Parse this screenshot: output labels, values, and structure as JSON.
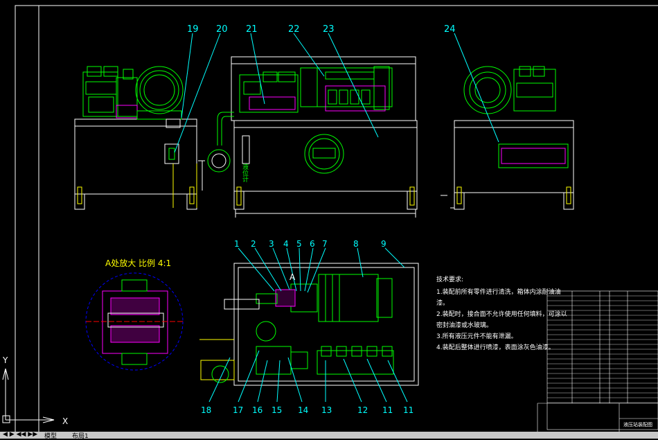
{
  "balloons_top": [
    "19",
    "20",
    "21",
    "22",
    "23",
    "24"
  ],
  "balloons_mid": [
    "1",
    "2",
    "3",
    "4",
    "5",
    "6",
    "7",
    "8",
    "9"
  ],
  "balloons_bottom": [
    "18",
    "17",
    "16",
    "15",
    "14",
    "13",
    "12",
    "11",
    "11"
  ],
  "detail_title": "A处放大 比例 4:1",
  "detail_marker": "A",
  "level_gauge_label": "液位计",
  "tech_notes": {
    "title": "技术要求:",
    "lines": [
      "1.装配前所有零件进行清洗，箱体内涂耐油油",
      "漆。",
      "2.装配时，接合面不允许使用任何填料，可涂以",
      "密封油漆或水玻璃。",
      "3.所有液压元件不能有泄漏。",
      "4.装配后整体进行喷漆，表面涂灰色油漆。"
    ]
  },
  "ucs": {
    "y": "Y",
    "x": "X"
  },
  "tabs": [
    "模型",
    "布局1"
  ],
  "title_block": {
    "drawing_name": "液压站装配图"
  },
  "colors": {
    "yellow": "#ffff00",
    "green": "#00ff00",
    "cyan": "#00ffff",
    "white": "#ffffff",
    "magenta": "#ff00ff",
    "blue": "#0000ff",
    "red": "#ff0000"
  }
}
